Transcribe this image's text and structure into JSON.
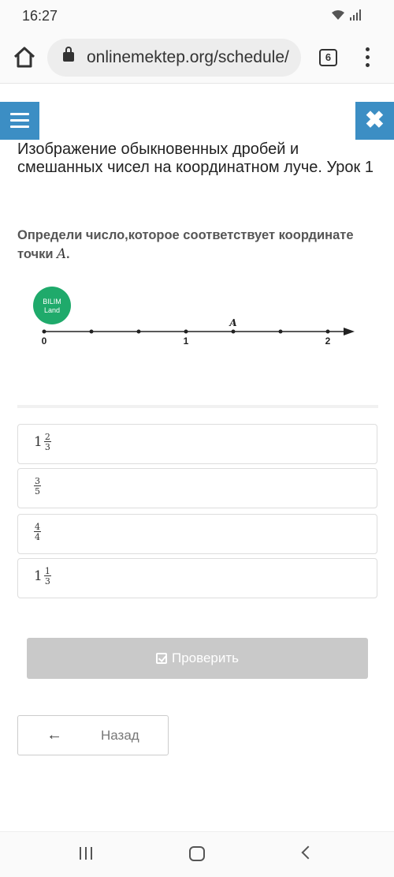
{
  "status_bar": {
    "time": "16:27",
    "icons": [
      "wifi-icon",
      "signal-icon"
    ]
  },
  "browser": {
    "url": "onlinemektep.org/schedule/",
    "tab_count": "6",
    "icons": [
      "home-icon",
      "lock-icon",
      "more-vert-icon"
    ]
  },
  "header": {
    "menu_icon": "hamburger-icon",
    "close_icon": "close-icon",
    "close_glyph": "✖",
    "accent_color": "#3c8ec4"
  },
  "lesson": {
    "title": "Изображение обыкновенных дробей и смешанных чисел на координатном луче. Урок 1"
  },
  "question": {
    "text": "Определи число,которое соответствует координате точки",
    "point_symbol": "A",
    "end": "."
  },
  "figure": {
    "logo_line1": "BILIM",
    "logo_line2": "Land",
    "point_label": "A",
    "tick_labels": [
      "0",
      "1",
      "2"
    ],
    "logo_color": "#1faa6b"
  },
  "options": [
    {
      "whole": "1",
      "num": "2",
      "den": "3"
    },
    {
      "whole": "",
      "num": "3",
      "den": "5"
    },
    {
      "whole": "",
      "num": "4",
      "den": "4"
    },
    {
      "whole": "1",
      "num": "1",
      "den": "3"
    }
  ],
  "actions": {
    "check_label": "Проверить",
    "check_icon": "check-square-icon",
    "back_label": "Назад",
    "back_icon": "arrow-left-icon",
    "back_glyph": "🡐"
  },
  "android_nav": {
    "icons": [
      "recent-apps-icon",
      "home-circle-icon",
      "back-chevron-icon"
    ]
  }
}
